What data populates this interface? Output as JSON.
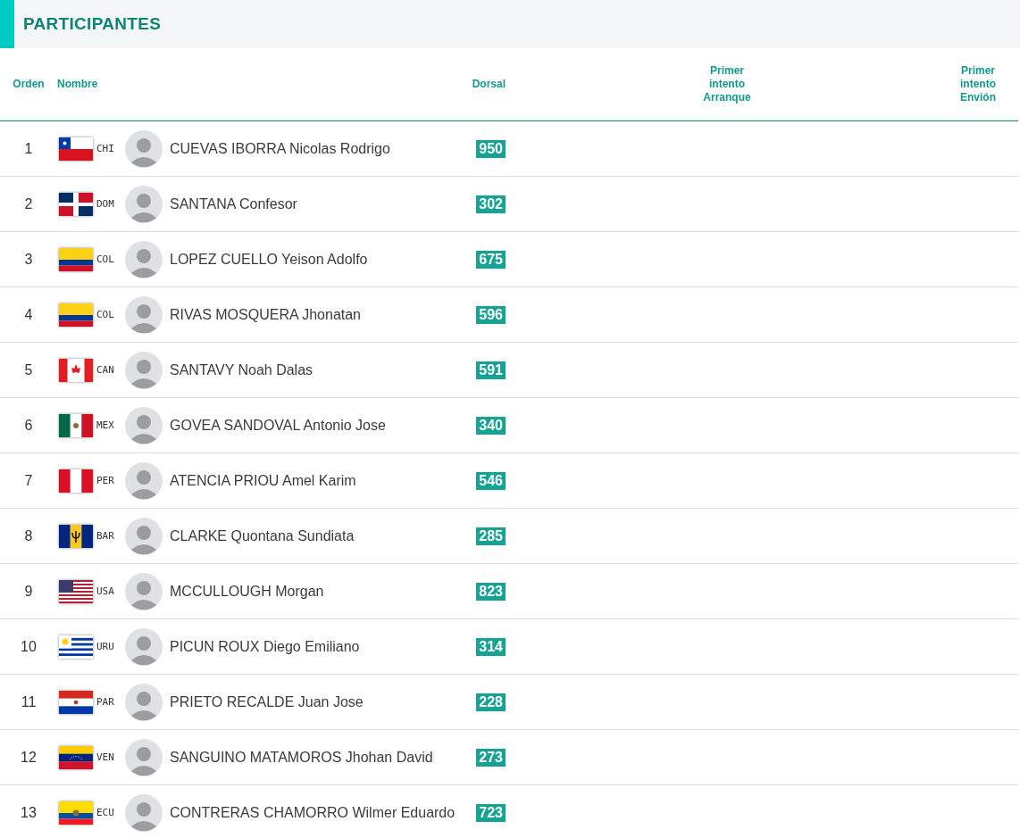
{
  "header": {
    "title": "PARTICIPANTES"
  },
  "table": {
    "columns": [
      "Orden",
      "Nombre",
      "Dorsal",
      "Primer intento Arranque",
      "Primer intento Envión"
    ],
    "rows": [
      {
        "order": "1",
        "kind": "chile",
        "country": "CHI",
        "name": "CUEVAS IBORRA Nicolas Rodrigo",
        "bib": "950"
      },
      {
        "order": "2",
        "kind": "dominican",
        "country": "DOM",
        "name": "SANTANA Confesor",
        "bib": "302"
      },
      {
        "order": "3",
        "kind": "colombia",
        "country": "COL",
        "name": "LOPEZ CUELLO Yeison Adolfo",
        "bib": "675"
      },
      {
        "order": "4",
        "kind": "colombia",
        "country": "COL",
        "name": "RIVAS MOSQUERA Jhonatan",
        "bib": "596"
      },
      {
        "order": "5",
        "kind": "canada",
        "country": "CAN",
        "name": "SANTAVY Noah Dalas",
        "bib": "591"
      },
      {
        "order": "6",
        "kind": "mexico",
        "country": "MEX",
        "name": "GOVEA SANDOVAL Antonio Jose",
        "bib": "340"
      },
      {
        "order": "7",
        "kind": "peru",
        "country": "PER",
        "name": "ATENCIA PRIOU Amel Karim",
        "bib": "546"
      },
      {
        "order": "8",
        "kind": "barbados",
        "country": "BAR",
        "name": "CLARKE Quontana Sundiata",
        "bib": "285"
      },
      {
        "order": "9",
        "kind": "usa",
        "country": "USA",
        "name": "MCCULLOUGH Morgan",
        "bib": "823"
      },
      {
        "order": "10",
        "kind": "uruguay",
        "country": "URU",
        "name": "PICUN ROUX Diego Emiliano",
        "bib": "314"
      },
      {
        "order": "11",
        "kind": "paraguay",
        "country": "PAR",
        "name": "PRIETO RECALDE Juan Jose",
        "bib": "228"
      },
      {
        "order": "12",
        "kind": "venezuela",
        "country": "VEN",
        "name": "SANGUINO MATAMOROS Jhohan David",
        "bib": "273"
      },
      {
        "order": "13",
        "kind": "ecuador",
        "country": "ECU",
        "name": "CONTRERAS CHAMORRO Wilmer Eduardo",
        "bib": "723"
      }
    ]
  }
}
